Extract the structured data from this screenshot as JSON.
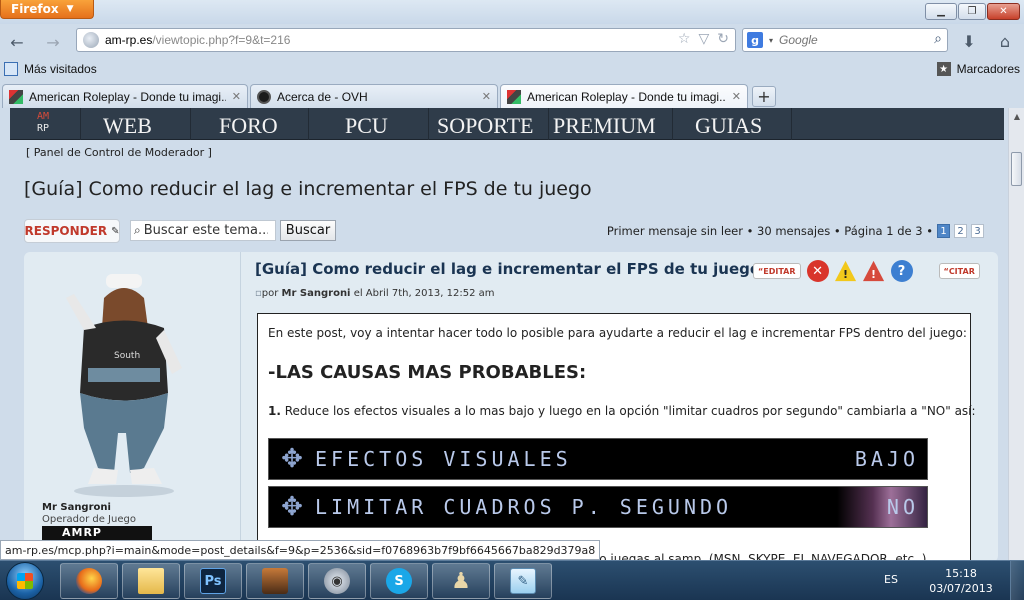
{
  "browser": {
    "app_button": "Firefox",
    "url_domain": "am-rp.es",
    "url_path": "/viewtopic.php?f=9&t=216",
    "search_placeholder": "Google",
    "search_engine_letter": "g"
  },
  "bookmarks": {
    "most_visited": "Más visitados",
    "bookmarks": "Marcadores"
  },
  "tabs": [
    {
      "label": "American Roleplay - Donde tu imagi...",
      "active": false
    },
    {
      "label": "Acerca de - OVH",
      "active": false
    },
    {
      "label": "American Roleplay - Donde tu imagi...",
      "active": true
    }
  ],
  "site": {
    "logo_top": "AM",
    "logo_bottom": "RP",
    "nav": [
      "WEB",
      "FORO",
      "PCU",
      "SOPORTE",
      "PREMIUM",
      "GUIAS"
    ]
  },
  "topic": {
    "mcp_link": "[ Panel de Control de Moderador ]",
    "title": "[Guía] Como reducir el lag e incrementar el FPS de tu juego",
    "reply_button": "RESPONDER",
    "search_value": "Buscar este tema...",
    "search_button": "Buscar",
    "pagination_text": "Primer mensaje sin leer • 30 mensajes • Página 1 de 3 •",
    "pages": [
      "1",
      "2",
      "3"
    ],
    "current_page": "1"
  },
  "post": {
    "author_name": "Mr Sangroni",
    "author_rank": "Operador de Juego",
    "author_badge": "AMRP",
    "subject": "[Guía] Como reducir el lag e incrementar el FPS de tu juego",
    "byline_prefix": "por",
    "byline_author": "Mr Sangroni",
    "byline_date": "el Abril 7th, 2013, 12:52 am",
    "edit_button": "EDITAR",
    "quote_button": "CITAR",
    "intro": "En este post, voy a intentar hacer todo lo posible para ayudarte a reducir el lag e incrementar FPS dentro del juego:",
    "heading": "-LAS CAUSAS MAS PROBABLES:",
    "step_number": "1.",
    "step_text": "Reduce los efectos visuales a lo mas bajo y luego en la opción \"limitar cuadros por segundo\" cambiarla a \"NO\" así:",
    "banner1_label": "EFECTOS VISUALES",
    "banner1_value": "BAJO",
    "banner2_label": "LIMITAR CUADROS P. SEGUNDO",
    "banner2_value": "NO",
    "partial_line": "lo cuando juegas al samp. (MSN, SKYPE, EL NAVEGADOR, etc..)"
  },
  "status_url": "am-rp.es/mcp.php?i=main&mode=post_details&f=9&p=2536&sid=f0768963b7f9bf6645667ba829d379a8",
  "taskbar": {
    "apps": [
      "firefox-icon",
      "folder-icon",
      "photoshop-icon",
      "game-icon",
      "teamspeak-icon",
      "skype-icon",
      "chess-icon",
      "notepad-icon"
    ],
    "ps_label": "Ps",
    "language": "ES",
    "time": "15:18",
    "date": "03/07/2013"
  }
}
